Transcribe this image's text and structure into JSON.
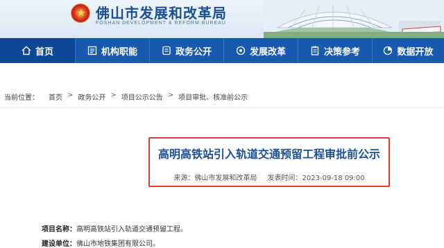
{
  "header": {
    "title": "佛山市发展和改革局",
    "subtitle": "FOSHAN DEVELOPMENT & REFORM BUREAU"
  },
  "nav": {
    "items": [
      {
        "label": "首页",
        "icon": "home-icon",
        "active": true
      },
      {
        "label": "机构职能",
        "icon": "org-chart-icon",
        "active": false
      },
      {
        "label": "政务公开",
        "icon": "document-icon",
        "active": false
      },
      {
        "label": "发展改革",
        "icon": "target-icon",
        "active": false
      },
      {
        "label": "决策参考",
        "icon": "clipboard-icon",
        "active": false
      },
      {
        "label": "数据开放",
        "icon": "pie-chart-icon",
        "active": false
      }
    ]
  },
  "breadcrumb": {
    "label": "当前位置：",
    "items": [
      "首页",
      "政务公开",
      "项目公示公告",
      "项目审批、核准前公示"
    ],
    "separator": ">"
  },
  "article": {
    "title": "高明高铁站引入轨道交通预留工程审批前公示",
    "source": "来源：佛山市发展和改革局",
    "date": "发表时间：2023-09-18 09:00"
  },
  "body": {
    "rows": [
      {
        "key": "项目名称：",
        "value": "高明高铁站引入轨道交通预留工程。"
      },
      {
        "key": "建设单位：",
        "value": "佛山市地铁集团有限公司。"
      }
    ]
  },
  "colors": {
    "nav_bg": "#1859b0",
    "title_blue": "#1a4f99",
    "highlight_red": "#e0392b"
  }
}
